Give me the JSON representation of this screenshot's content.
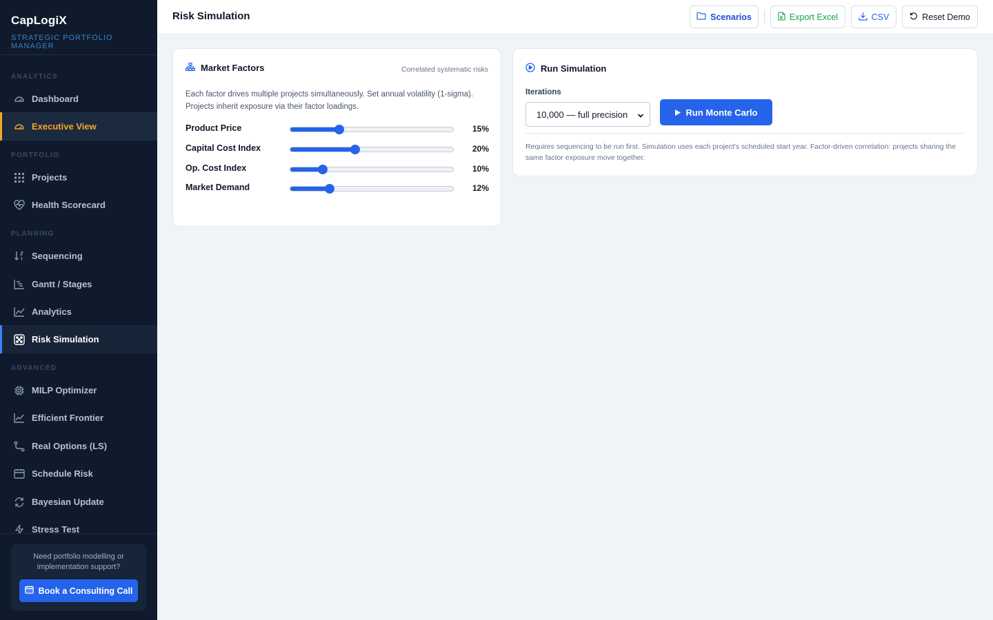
{
  "brand": {
    "title": "CapLogiX",
    "subtitle": "STRATEGIC PORTFOLIO MANAGER"
  },
  "sidebar": {
    "sections": [
      {
        "label": "ANALYTICS"
      },
      {
        "label": "PORTFOLIO"
      },
      {
        "label": "PLANNING"
      },
      {
        "label": "ADVANCED"
      }
    ],
    "items": [
      {
        "label": "Dashboard",
        "icon": "gauge-icon"
      },
      {
        "label": "Executive View",
        "icon": "gauge-icon"
      },
      {
        "label": "Projects",
        "icon": "grid-icon"
      },
      {
        "label": "Health Scorecard",
        "icon": "heart-pulse-icon"
      },
      {
        "label": "Sequencing",
        "icon": "sort-icon"
      },
      {
        "label": "Gantt / Stages",
        "icon": "gantt-icon"
      },
      {
        "label": "Analytics",
        "icon": "line-chart-icon"
      },
      {
        "label": "Risk Simulation",
        "icon": "dice-icon"
      },
      {
        "label": "MILP Optimizer",
        "icon": "chip-icon"
      },
      {
        "label": "Efficient Frontier",
        "icon": "trend-icon"
      },
      {
        "label": "Real Options (LS)",
        "icon": "branch-icon"
      },
      {
        "label": "Schedule Risk",
        "icon": "calendar-icon"
      },
      {
        "label": "Bayesian Update",
        "icon": "refresh-icon"
      },
      {
        "label": "Stress Test",
        "icon": "bolt-icon"
      }
    ],
    "consult": {
      "text": "Need portfolio modelling or implementation support?",
      "button": "Book a Consulting Call"
    }
  },
  "header": {
    "title": "Risk Simulation",
    "buttons": {
      "scenarios": "Scenarios",
      "export_excel": "Export Excel",
      "csv": "CSV",
      "reset": "Reset Demo"
    }
  },
  "market_factors": {
    "title": "Market Factors",
    "hint": "Correlated systematic risks",
    "description": "Each factor drives multiple projects simultaneously. Set annual volatility (1-sigma). Projects inherit exposure via their factor loadings.",
    "factors": [
      {
        "label": "Product Price",
        "value": "15%",
        "level": 0.3
      },
      {
        "label": "Capital Cost Index",
        "value": "20%",
        "level": 0.4
      },
      {
        "label": "Op. Cost Index",
        "value": "10%",
        "level": 0.2
      },
      {
        "label": "Market Demand",
        "value": "12%",
        "level": 0.24
      }
    ]
  },
  "run_simulation": {
    "title": "Run Simulation",
    "iterations_label": "Iterations",
    "iterations_selected": "10,000 — full precision",
    "run_button": "Run Monte Carlo",
    "note": "Requires sequencing to be run first. Simulation uses each project's scheduled start year. Factor-driven correlation: projects sharing the same factor exposure move together."
  },
  "colors": {
    "accent": "#2563eb",
    "sidebar_bg": "#0f1b2d",
    "highlight": "#f5a623",
    "excel_green": "#16a34a"
  }
}
